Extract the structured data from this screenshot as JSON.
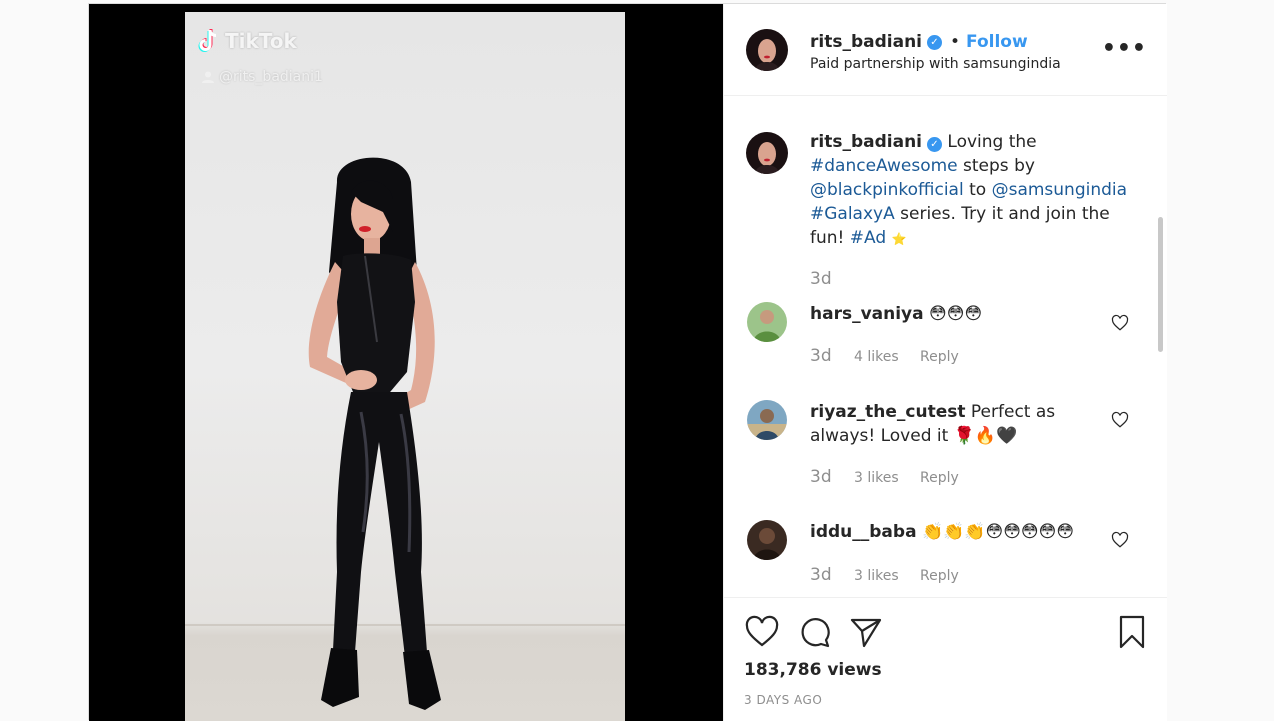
{
  "video": {
    "watermark": "TikTok",
    "watermark_handle": "@rits_badiani1"
  },
  "header": {
    "username": "rits_badiani",
    "separator": "•",
    "follow_label": "Follow",
    "partnership": "Paid partnership with samsungindia",
    "more_label": "•••"
  },
  "caption": {
    "username": "rits_badiani",
    "text_1": "Loving the",
    "hashtag_1": "#danceAwesome",
    "text_2": "steps by",
    "mention_1": "@blackpinkofficial",
    "text_3": "to",
    "mention_2": "@samsungindia",
    "hashtag_2": "#GalaxyA",
    "text_4": "series. Try it and join the fun!",
    "hashtag_3": "#Ad",
    "star": "⭐",
    "time": "3d"
  },
  "comments": [
    {
      "username": "hars_vaniya",
      "text": "😳😳😳",
      "time": "3d",
      "likes": "4 likes",
      "reply": "Reply"
    },
    {
      "username": "riyaz_the_cutest",
      "text": "Perfect as always! Loved it 🌹🔥🖤",
      "time": "3d",
      "likes": "3 likes",
      "reply": "Reply"
    },
    {
      "username": "iddu__baba",
      "text": "👏👏👏😳😳😳😳😳",
      "time": "3d",
      "likes": "3 likes",
      "reply": "Reply"
    }
  ],
  "footer": {
    "views": "183,786 views",
    "posted": "3 DAYS AGO"
  },
  "colors": {
    "link_blue": "#3897f0",
    "hashtag_blue": "#1c5a96",
    "muted_gray": "#8e8e8e",
    "border": "#dbdbdb"
  },
  "icons": [
    "tiktok-logo-icon",
    "user-icon",
    "verified-badge-icon",
    "more-options-icon",
    "heart-icon",
    "comment-icon",
    "share-icon",
    "bookmark-icon"
  ]
}
